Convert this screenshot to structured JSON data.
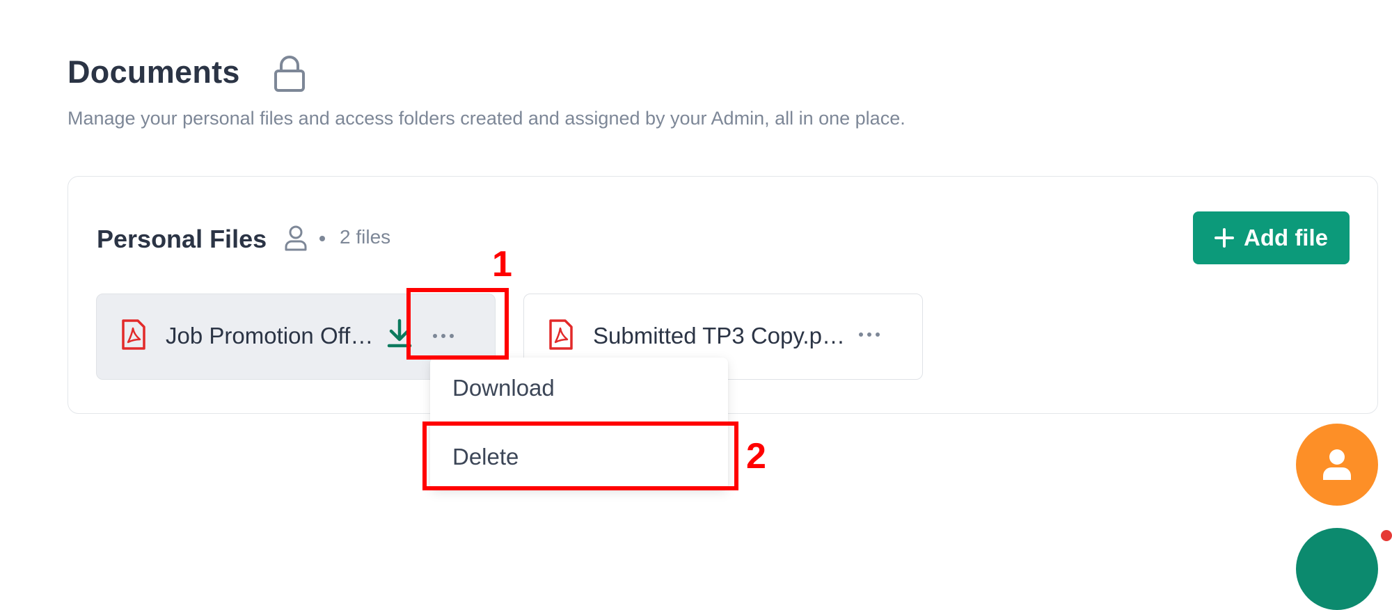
{
  "header": {
    "title": "Documents",
    "subtitle": "Manage your personal files and access folders created and assigned by your Admin, all in one place.",
    "title_icon": "lock-icon"
  },
  "personal_files": {
    "title": "Personal Files",
    "owner_icon": "person-icon",
    "count_label": "2 files",
    "add_button_label": "Add file",
    "add_button_icon": "plus-icon",
    "files": [
      {
        "name": "Job Promotion Off…",
        "icon": "pdf-icon",
        "hovered": true
      },
      {
        "name": "Submitted TP3 Copy.p…",
        "icon": "pdf-icon",
        "hovered": false
      }
    ]
  },
  "context_menu": {
    "items": [
      "Download",
      "Delete"
    ]
  },
  "annotations": [
    "1",
    "2"
  ],
  "fab": {
    "icon": "user-icon"
  },
  "colors": {
    "accent": "#0c9a7a",
    "fab": "#fd8f27",
    "pdf_red": "#e22a2a",
    "annotation_red": "#ff0000",
    "title": "#2b3445",
    "muted": "#7d8797"
  }
}
